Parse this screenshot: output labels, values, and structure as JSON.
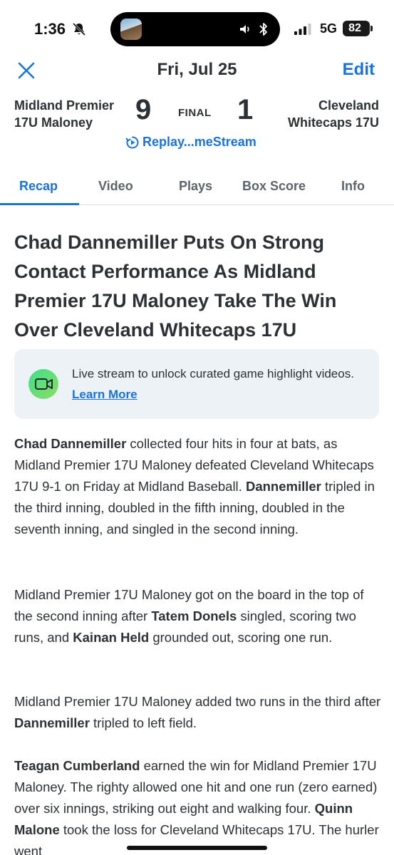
{
  "status_bar": {
    "time": "1:36",
    "network": "5G",
    "battery": "82"
  },
  "header": {
    "date": "Fri, Jul 25",
    "edit_label": "Edit"
  },
  "game": {
    "home_team_line1": "Midland Premier",
    "home_team_line2": "17U Maloney",
    "home_score": "9",
    "status": "FINAL",
    "away_score": "1",
    "away_team_line1": "Cleveland",
    "away_team_line2": "Whitecaps 17U",
    "replay_label": "Replay...meStream"
  },
  "tabs": [
    {
      "label": "Recap",
      "active": true
    },
    {
      "label": "Video",
      "active": false
    },
    {
      "label": "Plays",
      "active": false
    },
    {
      "label": "Box Score",
      "active": false
    },
    {
      "label": "Info",
      "active": false
    }
  ],
  "article": {
    "headline": "Chad Dannemiller Puts On Strong Contact Performance As Midland Premier 17U Maloney Take The Win Over Cleveland Whitecaps 17U",
    "promo_text": "Live stream to unlock curated game highlight videos.",
    "promo_link": "Learn More",
    "p1": [
      {
        "t": "Chad Dannemiller",
        "b": true
      },
      {
        "t": " collected four hits in four at bats, as Midland Premier 17U Maloney defeated Cleveland Whitecaps 17U 9-1 on Friday at Midland Baseball. ",
        "b": false
      },
      {
        "t": "Dannemiller",
        "b": true
      },
      {
        "t": " tripled in the third inning, doubled in the fifth inning, doubled in the seventh inning, and singled in the second inning.",
        "b": false
      }
    ],
    "p2": [
      {
        "t": "Midland Premier 17U Maloney got on the board in the top of the second inning after ",
        "b": false
      },
      {
        "t": "Tatem Donels",
        "b": true
      },
      {
        "t": " singled, scoring two runs, and ",
        "b": false
      },
      {
        "t": "Kainan Held",
        "b": true
      },
      {
        "t": " grounded out, scoring one run.",
        "b": false
      }
    ],
    "p3": [
      {
        "t": "Midland Premier 17U Maloney added two runs in the third after ",
        "b": false
      },
      {
        "t": "Dannemiller",
        "b": true
      },
      {
        "t": " tripled to left field.",
        "b": false
      }
    ],
    "p4": [
      {
        "t": "Teagan Cumberland",
        "b": true
      },
      {
        "t": " earned the win for Midland Premier 17U Maloney. The righty allowed one hit and one run (zero earned) over six innings, striking out eight and walking four. ",
        "b": false
      },
      {
        "t": "Quinn Malone",
        "b": true
      },
      {
        "t": " took the loss for Cleveland Whitecaps 17U. The hurler went",
        "b": false
      }
    ]
  },
  "colors": {
    "accent": "#1a73d9",
    "text": "#2b3135",
    "promo_bg": "#edf2f7",
    "promo_icon": "#3de08a"
  }
}
